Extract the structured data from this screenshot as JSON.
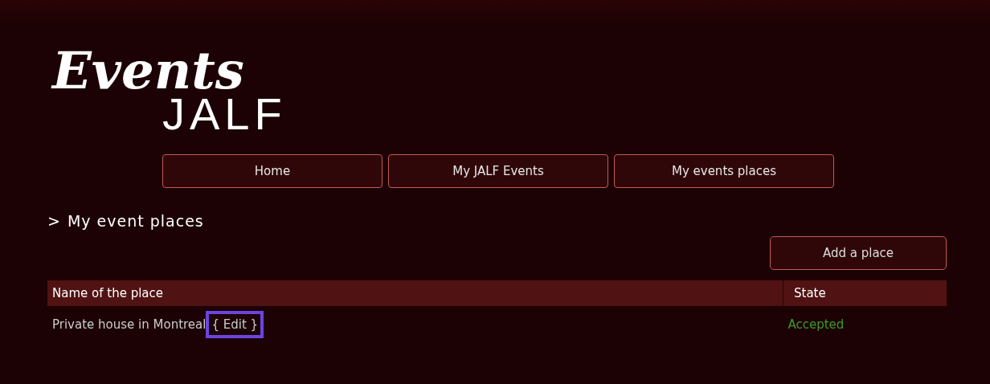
{
  "logo": {
    "script_word": "Events",
    "brand_word": "JALF"
  },
  "nav": [
    {
      "label": "Home"
    },
    {
      "label": "My JALF Events"
    },
    {
      "label": "My events places"
    }
  ],
  "section": {
    "marker": ">",
    "title": "My event places"
  },
  "add_button": {
    "label": "Add a place"
  },
  "table": {
    "columns": [
      "Name of the place",
      "State"
    ],
    "rows": [
      {
        "name": "Private house in Montreal",
        "edit_link": {
          "label": "{ Edit }",
          "highlighted": true
        },
        "state": "Accepted",
        "accepted": true
      }
    ]
  }
}
